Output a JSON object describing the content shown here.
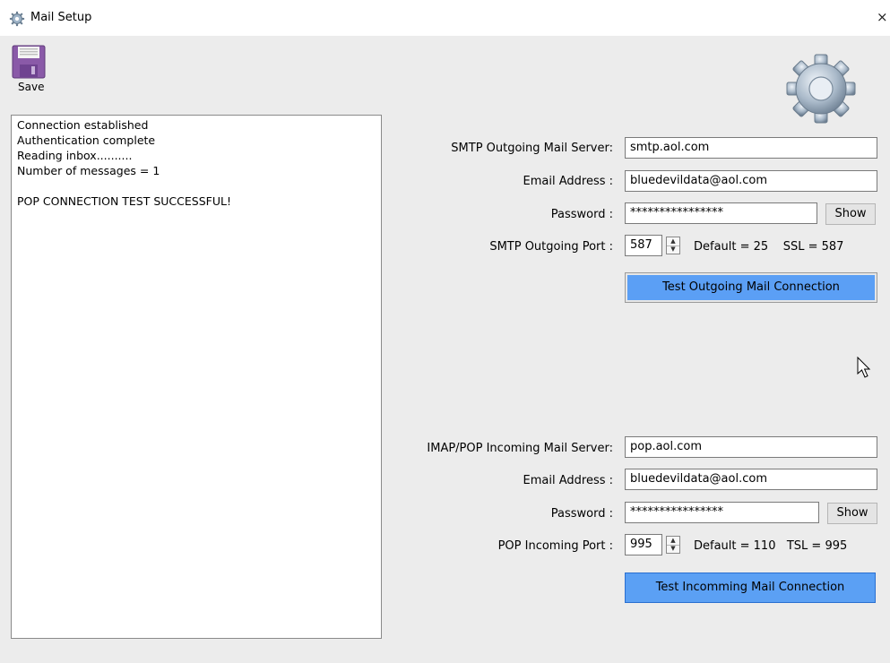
{
  "window": {
    "title": "Mail Setup",
    "close_glyph": "×"
  },
  "toolbar": {
    "save_label": "Save",
    "save_icon": "floppy-disk-icon"
  },
  "log_lines": [
    "Connection established",
    "Authentication complete",
    "Reading inbox..........",
    "Number of messages = 1",
    "",
    "POP CONNECTION TEST SUCCESSFUL!"
  ],
  "outgoing": {
    "server_label": "SMTP Outgoing Mail Server:",
    "server_value": "smtp.aol.com",
    "email_label": "Email Address :",
    "email_value": "bluedevildata@aol.com",
    "password_label": "Password :",
    "password_value": "****************",
    "show_label": "Show",
    "port_label": "SMTP Outgoing Port :",
    "port_value": "587",
    "port_info": "Default = 25    SSL = 587",
    "test_button": "Test Outgoing Mail Connection"
  },
  "incoming": {
    "server_label": "IMAP/POP Incoming Mail Server:",
    "server_value": "pop.aol.com",
    "email_label": "Email Address :",
    "email_value": "bluedevildata@aol.com",
    "password_label": "Password :",
    "password_value": "****************",
    "show_label": "Show",
    "port_label": "POP Incoming Port :",
    "port_value": "995",
    "port_info": "Default = 110   TSL = 995",
    "test_button": "Test Incomming Mail Connection"
  },
  "colors": {
    "button_blue": "#5b9ff5",
    "background": "#ececec"
  }
}
